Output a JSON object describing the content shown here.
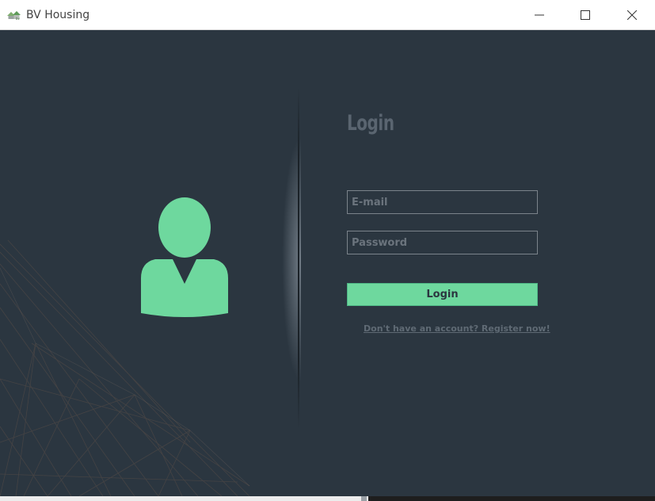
{
  "window": {
    "title": "BV Housing",
    "app_icon": "house-logo-icon",
    "controls": {
      "minimize_icon": "minimize-icon",
      "maximize_icon": "maximize-icon",
      "close_icon": "close-icon"
    }
  },
  "login": {
    "heading": "Login",
    "email_placeholder": "E-mail",
    "email_value": "",
    "password_placeholder": "Password",
    "password_value": "",
    "button_label": "Login",
    "register_link": "Don't have an account? Register now!"
  },
  "avatar_icon": "user-avatar-icon",
  "colors": {
    "background": "#2b3640",
    "accent": "#6ed89e",
    "muted_text": "#5f6a74"
  }
}
